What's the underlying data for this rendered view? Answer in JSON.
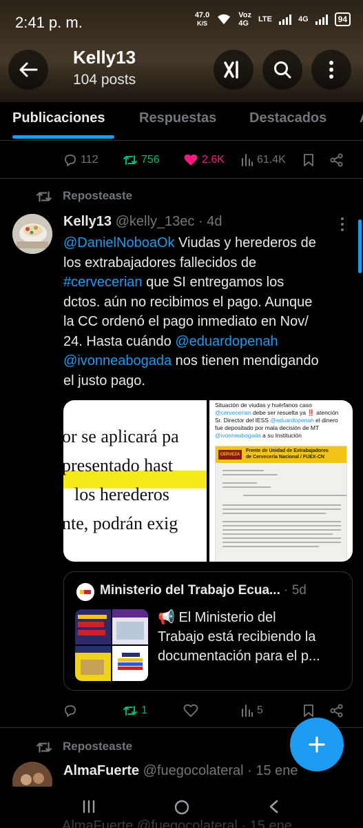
{
  "status": {
    "time": "2:41 p. m.",
    "net_speed_value": "47.0",
    "net_speed_unit": "K/S",
    "voz_label": "Voz",
    "voz_sub": "4G",
    "lte_label": "LTE",
    "network_label": "4G",
    "battery": "94"
  },
  "header": {
    "name": "Kelly13",
    "posts": "104 posts",
    "icons": [
      "back-arrow-icon",
      "xai-grok-icon",
      "search-icon",
      "more-vertical-icon"
    ]
  },
  "tabs": [
    {
      "label": "Publicaciones",
      "active": true
    },
    {
      "label": "Respuestas",
      "active": false
    },
    {
      "label": "Destacados",
      "active": false
    },
    {
      "label": "A",
      "active": false
    }
  ],
  "prev_actions": {
    "replies": "112",
    "reposts": "756",
    "likes": "2.6K",
    "views": "61.4K"
  },
  "tweet1": {
    "repost_label": "Reposteaste",
    "name": "Kelly13",
    "handle": "@kelly_13ec",
    "time": "· 4d",
    "text_lines": [
      [
        {
          "t": "@DanielNoboaOk",
          "link": true
        },
        {
          "t": "  Viudas y herederos de",
          "link": false
        }
      ],
      [
        {
          "t": "los extrabajadores fallecidos de",
          "link": false
        }
      ],
      [
        {
          "t": "#cervecerian",
          "link": true
        },
        {
          "t": " que SI entregamos los",
          "link": false
        }
      ],
      [
        {
          "t": "dctos. aún no recibimos el pago. Aunque",
          "link": false
        }
      ],
      [
        {
          "t": "la CC ordenó el pago inmediato en Nov/",
          "link": false
        }
      ],
      [
        {
          "t": "24. Hasta cuándo ",
          "link": false
        },
        {
          "t": "@eduardopenah",
          "link": true
        }
      ],
      [
        {
          "t": "@ivonneabogada",
          "link": true
        },
        {
          "t": " nos tienen mendigando",
          "link": false
        }
      ],
      [
        {
          "t": "el justo pago.",
          "link": false
        }
      ]
    ],
    "media_a_lines": [
      "or se aplicará pa",
      "presentado hast",
      "los herederos",
      "nte, podrán exig"
    ],
    "media_b": {
      "caption_1": "Situación de viudas y huérfanos caso",
      "caption_2_link": "@cervecerian",
      "caption_2_rest": "  debe ser resuelta ya ‼️ atención",
      "caption_3_pre": "Sr. Director del IESS ",
      "caption_3_link": "@eduardopenah",
      "caption_3_rest": " el dinero",
      "caption_4": "fue depositado por mala decisión de MT",
      "caption_5_link": "@ivonneabogada",
      "caption_5_rest": " a su Institución",
      "doc_logo": "CERVEZA",
      "doc_title_1": "Frente de Unidad de Extrabajadores",
      "doc_title_2": "de Cervecería Nacional / FUEX-CN"
    },
    "quote": {
      "name": "Ministerio del Trabajo Ecua...",
      "time": "· 5d",
      "text_lines": [
        "📢 El Ministerio del",
        "Trabajo está recibiendo la",
        "documentación para el p..."
      ]
    },
    "actions": {
      "replies": "",
      "reposts": "1",
      "likes": "",
      "views": "5"
    }
  },
  "tweet2": {
    "repost_label": "Reposteaste",
    "name": "AlmaFuerte",
    "handle": "@fuegocolateral",
    "time": "· 15 ene"
  },
  "navbar_peek": "AlmaFuerte @fuegocolateral · 15 ene",
  "colors": {
    "accent": "#1d9bf0",
    "like": "#f91880",
    "repost": "#00ba7c",
    "muted": "#71767b",
    "text": "#e7e9ea",
    "background": "#000000"
  }
}
